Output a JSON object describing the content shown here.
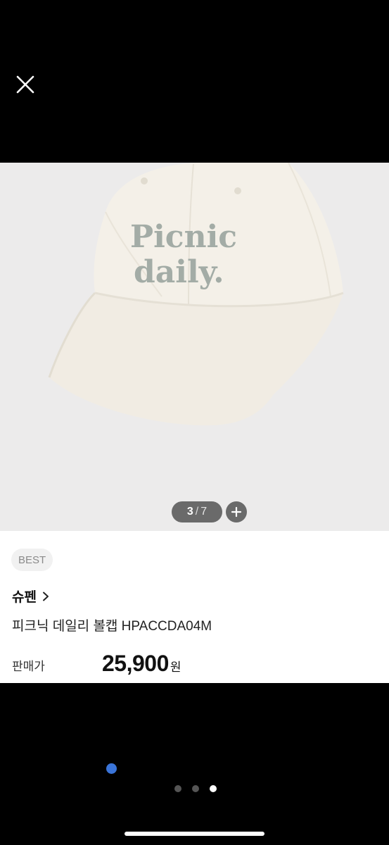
{
  "close_icon": "close-icon",
  "image_counter": {
    "current": "3",
    "separator": "/",
    "total": "7"
  },
  "zoom_icon": "plus-icon",
  "product": {
    "badge": "BEST",
    "brand": "슈펜",
    "name": "피크닉 데일리 볼캡 HPACCDA04M",
    "price_label": "판매가",
    "price_value": "25,900",
    "price_unit": "원",
    "cap_logo_line1": "Picnic",
    "cap_logo_line2": "daily."
  },
  "pager": {
    "count": 3,
    "active_index": 2
  },
  "colors": {
    "accent_dot": "#3a74d8",
    "photo_bg": "#ecebeb",
    "cap_color": "#f4f0e8",
    "logo_color": "#a3aca6"
  }
}
